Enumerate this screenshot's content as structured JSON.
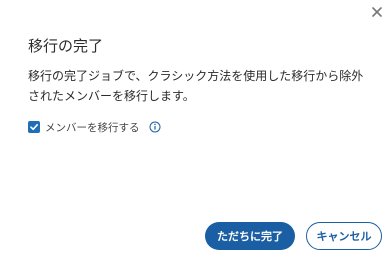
{
  "dialog": {
    "title": "移行の完了",
    "description": "移行の完了ジョブで、クラシック方法を使用した移行から除外されたメンバーを移行します。",
    "checkbox": {
      "label": "メンバーを移行する",
      "checked": true
    },
    "buttons": {
      "primary_label": "ただちに完了",
      "secondary_label": "キャンセル"
    }
  },
  "colors": {
    "accent": "#1a5fa3",
    "text": "#2b2b2b",
    "close_icon": "#777777"
  },
  "icons": {
    "close": "close-icon",
    "checkbox": "checkmark-icon",
    "info": "info-icon"
  }
}
